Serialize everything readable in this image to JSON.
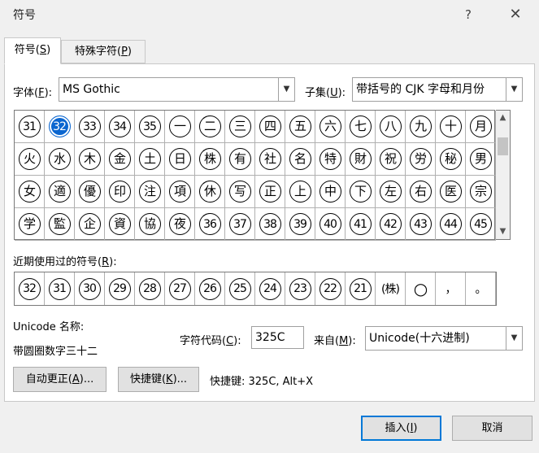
{
  "window": {
    "title": "符号",
    "help_glyph": "?",
    "close_glyph": "✕"
  },
  "tabs": [
    {
      "prefix": "符号(",
      "key": "S",
      "suffix": ")",
      "active": true
    },
    {
      "prefix": "特殊字符(",
      "key": "P",
      "suffix": ")",
      "active": false
    }
  ],
  "font": {
    "label_prefix": "字体(",
    "label_key": "F",
    "label_suffix": "):",
    "value": "MS Gothic"
  },
  "subset": {
    "label_prefix": "子集(",
    "label_key": "U",
    "label_suffix": "):",
    "value": "带括号的 CJK 字母和月份"
  },
  "symbol_grid": {
    "selected_index": 1,
    "cells": [
      "31",
      "32",
      "33",
      "34",
      "35",
      "一",
      "二",
      "三",
      "四",
      "五",
      "六",
      "七",
      "八",
      "九",
      "十",
      "月",
      "火",
      "水",
      "木",
      "金",
      "土",
      "日",
      "株",
      "有",
      "社",
      "名",
      "特",
      "財",
      "祝",
      "労",
      "秘",
      "男",
      "女",
      "適",
      "優",
      "印",
      "注",
      "項",
      "休",
      "写",
      "正",
      "上",
      "中",
      "下",
      "左",
      "右",
      "医",
      "宗",
      "学",
      "監",
      "企",
      "資",
      "協",
      "夜",
      "36",
      "37",
      "38",
      "39",
      "40",
      "41",
      "42",
      "43",
      "44",
      "45"
    ]
  },
  "recent": {
    "label_prefix": "近期使用过的符号(",
    "label_key": "R",
    "label_suffix": "):",
    "cells": [
      "32",
      "31",
      "30",
      "29",
      "28",
      "27",
      "26",
      "25",
      "24",
      "23",
      "22",
      "21",
      "(株)",
      "○",
      "，",
      "。"
    ]
  },
  "unicode_name": {
    "label": "Unicode 名称:",
    "value": "带圆圈数字三十二"
  },
  "char_code": {
    "label_prefix": "字符代码(",
    "label_key": "C",
    "label_suffix": "):",
    "value": "325C"
  },
  "from": {
    "label_prefix": "来自(",
    "label_key": "M",
    "label_suffix": "):",
    "value": "Unicode(十六进制)"
  },
  "buttons": {
    "autocorrect": {
      "prefix": "自动更正(",
      "key": "A",
      "suffix": ")..."
    },
    "shortcut_key": {
      "prefix": "快捷键(",
      "key": "K",
      "suffix": ")..."
    },
    "insert": {
      "prefix": "插入(",
      "key": "I",
      "suffix": ")"
    },
    "cancel": "取消"
  },
  "shortcut_text": "快捷键: 325C, Alt+X",
  "colors": {
    "selection": "#0b66d0",
    "default_button_border": "#0078d7"
  }
}
